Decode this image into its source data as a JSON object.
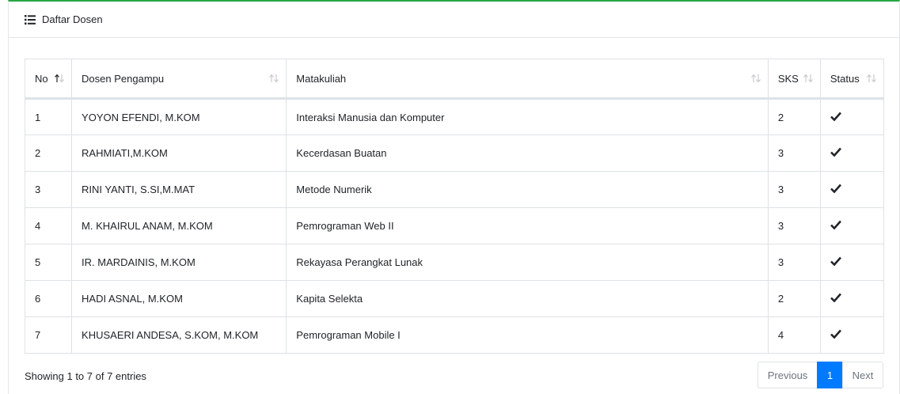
{
  "card": {
    "title": "Daftar Dosen"
  },
  "table": {
    "headers": [
      "No",
      "Dosen Pengampu",
      "Matakuliah",
      "SKS",
      "Status"
    ],
    "rows": [
      {
        "no": "1",
        "dosen": "YOYON EFENDI, M.KOM",
        "matakuliah": "Interaksi Manusia dan Komputer",
        "sks": "2",
        "status_icon": "check-icon"
      },
      {
        "no": "2",
        "dosen": "RAHMIATI,M.KOM",
        "matakuliah": "Kecerdasan Buatan",
        "sks": "3",
        "status_icon": "check-icon"
      },
      {
        "no": "3",
        "dosen": "RINI YANTI, S.SI,M.MAT",
        "matakuliah": "Metode Numerik",
        "sks": "3",
        "status_icon": "check-icon"
      },
      {
        "no": "4",
        "dosen": "M. KHAIRUL ANAM, M.KOM",
        "matakuliah": "Pemrograman Web II",
        "sks": "3",
        "status_icon": "check-icon"
      },
      {
        "no": "5",
        "dosen": "IR. MARDAINIS, M.KOM",
        "matakuliah": "Rekayasa Perangkat Lunak",
        "sks": "3",
        "status_icon": "check-icon"
      },
      {
        "no": "6",
        "dosen": "HADI ASNAL, M.KOM",
        "matakuliah": "Kapita Selekta",
        "sks": "2",
        "status_icon": "check-icon"
      },
      {
        "no": "7",
        "dosen": "KHUSAERI ANDESA, S.KOM, M.KOM",
        "matakuliah": "Pemrograman Mobile I",
        "sks": "4",
        "status_icon": "check-icon"
      }
    ]
  },
  "footer": {
    "info": "Showing 1 to 7 of 7 entries",
    "pagination": {
      "previous": "Previous",
      "current": "1",
      "next": "Next"
    }
  },
  "colors": {
    "accent_top": "#28a745",
    "active_page": "#007bff"
  }
}
